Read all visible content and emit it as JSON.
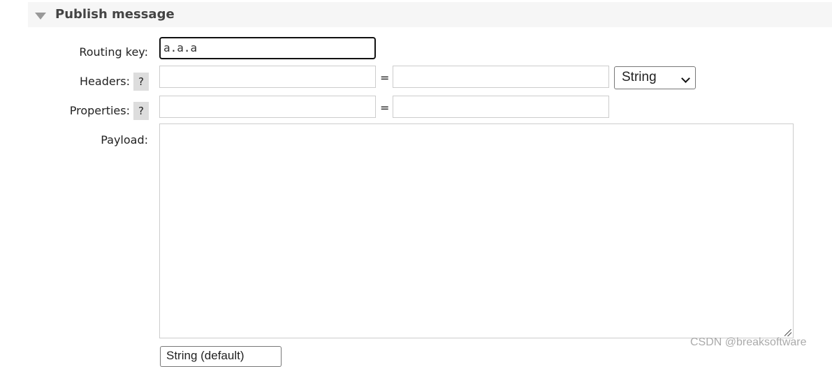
{
  "section": {
    "title": "Publish message",
    "icon": "triangle-down-icon"
  },
  "form": {
    "routing_key": {
      "label": "Routing key:",
      "value": "a.a.a"
    },
    "headers": {
      "label": "Headers:",
      "help": "?",
      "key": "",
      "equals": "=",
      "value": "",
      "type": "String"
    },
    "properties": {
      "label": "Properties:",
      "help": "?",
      "key": "",
      "equals": "=",
      "value": ""
    },
    "payload": {
      "label": "Payload:",
      "value": ""
    },
    "encoding": {
      "value": "String (default)"
    }
  },
  "watermark": "CSDN @breaksoftware"
}
